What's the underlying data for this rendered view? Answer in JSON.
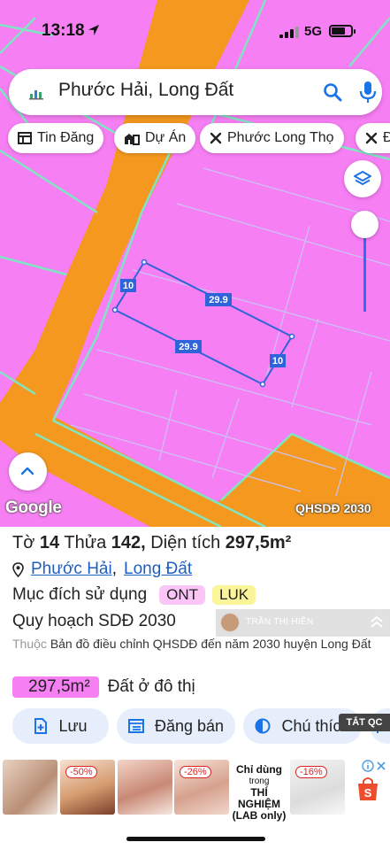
{
  "status": {
    "time": "13:18",
    "network": "5G"
  },
  "search": {
    "query": "Phước Hải, Long Đất"
  },
  "chips": [
    "Tin Đăng",
    "Dự Án",
    "Phước Long Thọ",
    "Đ"
  ],
  "map": {
    "edge_labels": [
      "10",
      "29.9",
      "29.9",
      "10"
    ],
    "attribution": "Google",
    "layer_name": "QHSDĐ 2030",
    "colors": {
      "residential": "#f77ff4",
      "road": "#f4981f",
      "boundary": "#7ee6c2",
      "parcel": "#2f63d9"
    }
  },
  "parcel": {
    "sheet_label": "Tờ",
    "sheet": "14",
    "plot_label": "Thửa",
    "plot": "142,",
    "area_label": "Diện tích",
    "area": "297,5m²",
    "ward": "Phước Hải",
    "separator": ",",
    "district": "Long Đất",
    "purpose_label": "Mục đích sử dụng",
    "purpose_tags": [
      "ONT",
      "LUK"
    ],
    "plan_title": "Quy hoạch SDĐ 2030",
    "source_prefix": "Thuộc",
    "source_text": "Bản đồ điều chỉnh QHSDĐ đến năm 2030 huyện Long Đất",
    "zone_area": "297,5m²",
    "zone_name": "Đất ở đô thị",
    "watermark_name": "TRẦN THỊ HIỀN"
  },
  "actions": [
    "Lưu",
    "Đăng bán",
    "Chú thích"
  ],
  "ad": {
    "close_label": "TẮT QC",
    "discounts": [
      "-50%",
      "-26%",
      "-16%"
    ],
    "cta_lines": [
      "Chỉ dùng",
      "trong",
      "THÍ NGHIỆM",
      "(LAB only)"
    ]
  }
}
